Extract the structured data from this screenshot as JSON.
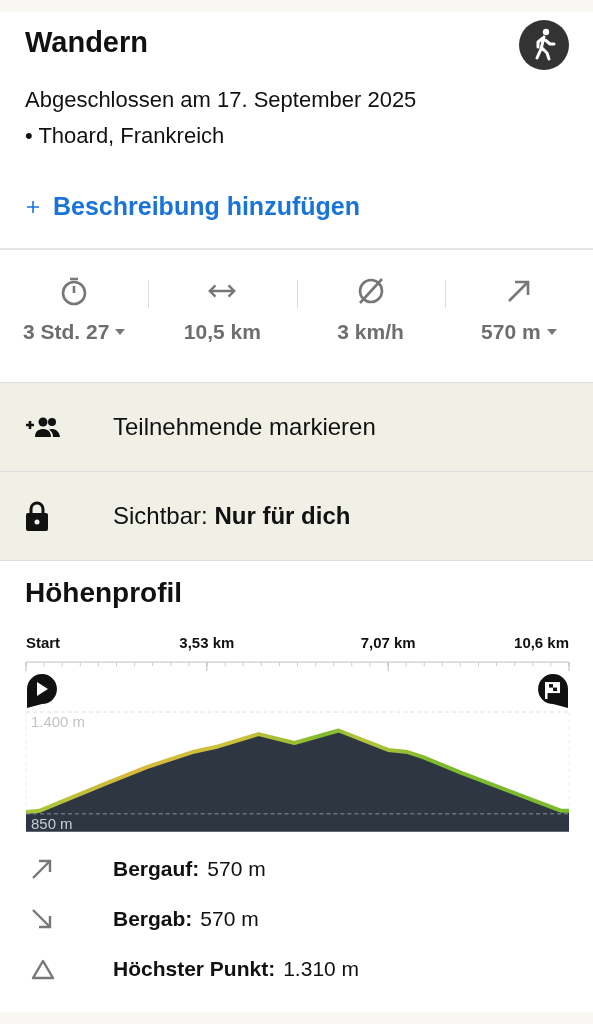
{
  "activity": {
    "title": "Wandern",
    "completed": "Abgeschlossen am 17. September 2025",
    "location": "• Thoard, Frankreich",
    "add_description": "Beschreibung hinzufügen"
  },
  "stats": [
    {
      "kind": "duration",
      "value": "3 Std. 27",
      "dropdown": true
    },
    {
      "kind": "distance",
      "value": "10,5 km",
      "dropdown": false
    },
    {
      "kind": "speed",
      "value": "3 km/h",
      "dropdown": false
    },
    {
      "kind": "ascent",
      "value": "570 m",
      "dropdown": true
    }
  ],
  "actions": [
    {
      "kind": "participants",
      "text": "Teilnehmende markieren"
    },
    {
      "kind": "visibility",
      "text": "Sichtbar: **Nur für dich**"
    }
  ],
  "elevation": {
    "title": "Höhenprofil",
    "chart_data": {
      "type": "area",
      "x": [
        0,
        0.26,
        1.54,
        2.36,
        3.25,
        3.7,
        4.54,
        5.24,
        6.1,
        7.07,
        7.45,
        7.75,
        8.5,
        10.45,
        10.6
      ],
      "series": [
        {
          "color": "#2d3641",
          "values": [
            860,
            866,
            1012,
            1103,
            1184,
            1211,
            1281,
            1233,
            1300,
            1195,
            1184,
            1157,
            1071,
            866,
            866
          ]
        }
      ],
      "xlim": [
        0,
        10.6
      ],
      "ylim": [
        753,
        1400
      ],
      "xticks": [
        {
          "value": 0,
          "label": "Start"
        },
        {
          "value": 3.53,
          "label": "3,53 km"
        },
        {
          "value": 7.07,
          "label": "7,07 km"
        },
        {
          "value": 10.6,
          "label": "10,6 km"
        }
      ],
      "yticks": [
        {
          "value": 850,
          "label": "850 m"
        },
        {
          "value": 1400,
          "label": "1.400 m"
        }
      ]
    },
    "summary": [
      {
        "kind": "up",
        "label": "Bergauf:",
        "value": "570 m"
      },
      {
        "kind": "down",
        "label": "Bergab:",
        "value": "570 m"
      },
      {
        "kind": "peak",
        "label": "Höchster Punkt:",
        "value": "1.310 m"
      }
    ]
  }
}
